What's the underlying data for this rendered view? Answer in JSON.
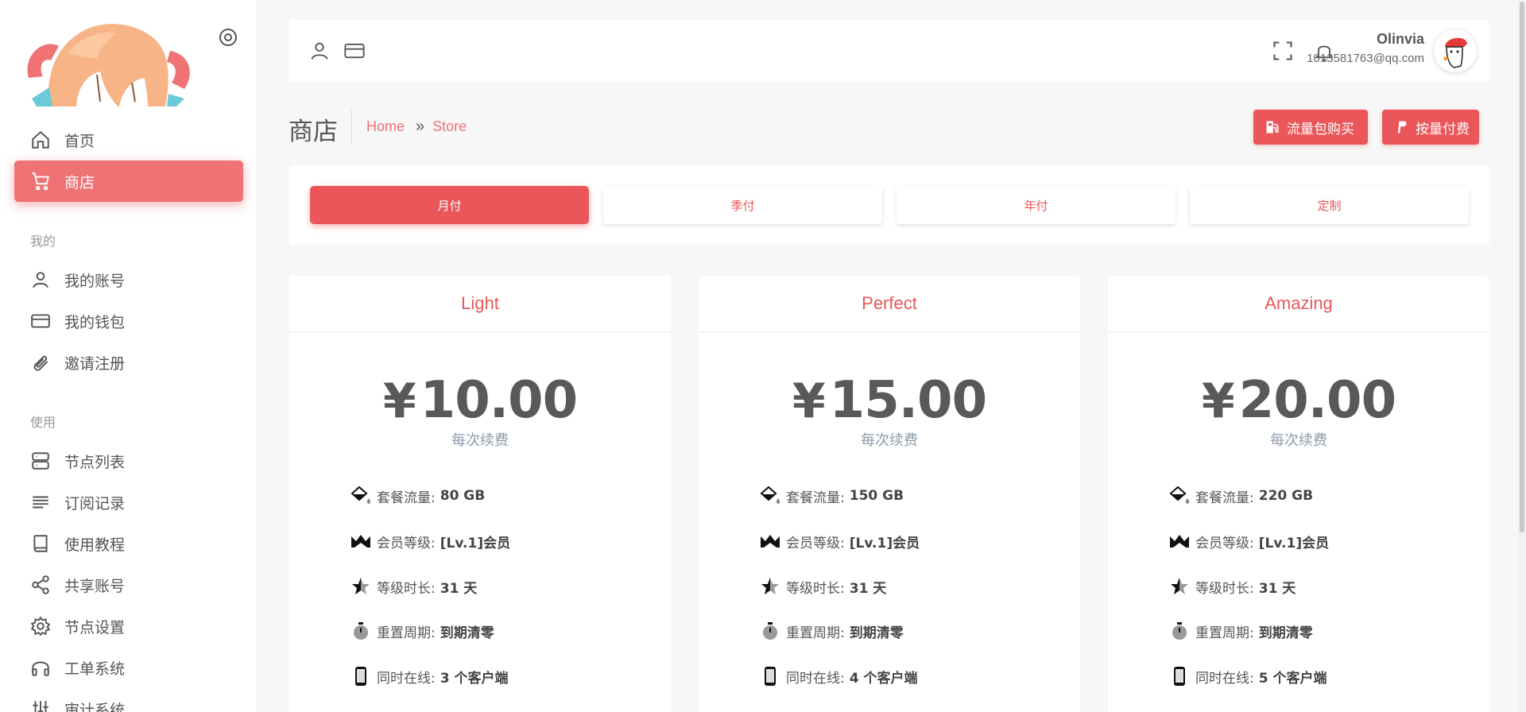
{
  "sidebar": {
    "items": [
      {
        "label": "首页",
        "icon": "home-icon"
      },
      {
        "label": "商店",
        "icon": "cart-icon",
        "active": true
      },
      {
        "label": "我的账号",
        "icon": "user-icon"
      },
      {
        "label": "我的钱包",
        "icon": "wallet-icon"
      },
      {
        "label": "邀请注册",
        "icon": "paperclip-icon"
      },
      {
        "label": "节点列表",
        "icon": "server-icon"
      },
      {
        "label": "订阅记录",
        "icon": "lines-icon"
      },
      {
        "label": "使用教程",
        "icon": "book-icon"
      },
      {
        "label": "共享账号",
        "icon": "share-icon"
      },
      {
        "label": "节点设置",
        "icon": "gear-icon"
      },
      {
        "label": "工单系统",
        "icon": "headphones-icon"
      },
      {
        "label": "审计系统",
        "icon": "sliders-icon"
      }
    ],
    "sections": {
      "mine": "我的",
      "use": "使用"
    }
  },
  "header": {
    "user_name": "Olinvia",
    "user_email": "1013581763@qq.com"
  },
  "page": {
    "title": "商店",
    "breadcrumb": {
      "home": "Home",
      "sep": "»",
      "current": "Store"
    },
    "actions": {
      "traffic": "流量包购买",
      "payg": "按量付费"
    }
  },
  "tabs": [
    {
      "label": "月付",
      "active": true
    },
    {
      "label": "季付"
    },
    {
      "label": "年付"
    },
    {
      "label": "定制"
    }
  ],
  "plans": [
    {
      "name": "Light",
      "currency": "¥",
      "price": "10.00",
      "price_note": "每次续费",
      "features": [
        {
          "label": "套餐流量:",
          "value": "80 GB"
        },
        {
          "label": "会员等级:",
          "value": "[Lv.1]会员"
        },
        {
          "label": "等级时长:",
          "value": "31 天"
        },
        {
          "label": "重置周期:",
          "value": "到期清零"
        },
        {
          "label": "同时在线:",
          "value": "3 个客户端"
        }
      ]
    },
    {
      "name": "Perfect",
      "currency": "¥",
      "price": "15.00",
      "price_note": "每次续费",
      "features": [
        {
          "label": "套餐流量:",
          "value": "150 GB"
        },
        {
          "label": "会员等级:",
          "value": "[Lv.1]会员"
        },
        {
          "label": "等级时长:",
          "value": "31 天"
        },
        {
          "label": "重置周期:",
          "value": "到期清零"
        },
        {
          "label": "同时在线:",
          "value": "4 个客户端"
        }
      ]
    },
    {
      "name": "Amazing",
      "currency": "¥",
      "price": "20.00",
      "price_note": "每次续费",
      "features": [
        {
          "label": "套餐流量:",
          "value": "220 GB"
        },
        {
          "label": "会员等级:",
          "value": "[Lv.1]会员"
        },
        {
          "label": "等级时长:",
          "value": "31 天"
        },
        {
          "label": "重置周期:",
          "value": "到期清零"
        },
        {
          "label": "同时在线:",
          "value": "5 个客户端"
        }
      ]
    }
  ],
  "colors": {
    "accent": "#ea5659",
    "active_nav": "#ef7274"
  }
}
